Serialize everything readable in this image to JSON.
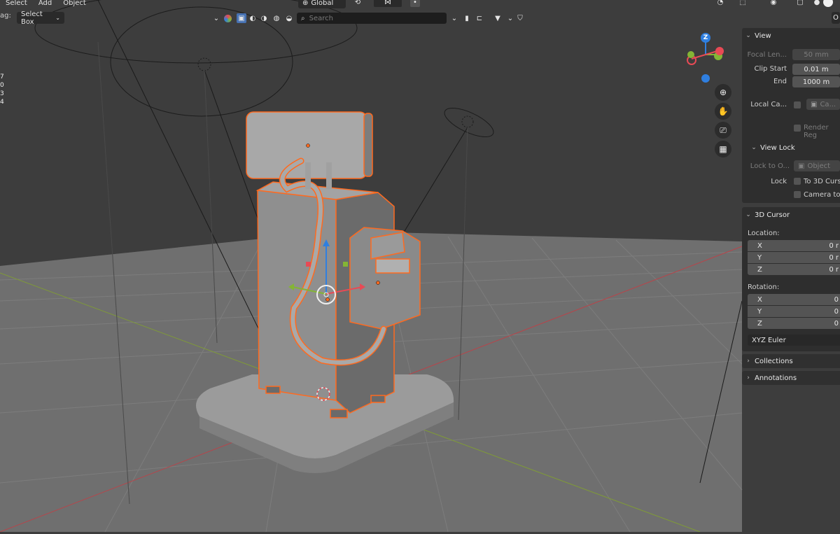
{
  "menu": {
    "select": "Select",
    "add": "Add",
    "object": "Object"
  },
  "toolbar": {
    "drag_label": "ag:",
    "select_box": "Select Box",
    "orientation": "Global",
    "search_placeholder": "Search"
  },
  "stats": [
    "7",
    "0",
    "3",
    "4"
  ],
  "npanel": {
    "view": {
      "title": "View",
      "focal_length_label": "Focal Len...",
      "focal_length_value": "50 mm",
      "clip_start_label": "Clip Start",
      "clip_start_value": "0.01 m",
      "clip_end_label": "End",
      "clip_end_value": "1000 m",
      "local_camera_label": "Local Ca...",
      "local_camera_value": "Ca...",
      "render_region_label": "Render Reg"
    },
    "view_lock": {
      "title": "View Lock",
      "lock_to_object_label": "Lock to O...",
      "lock_to_object_value": "Object",
      "lock_label": "Lock",
      "to_3d_cursor": "To 3D Curs",
      "camera_to": "Camera to"
    },
    "cursor": {
      "title": "3D Cursor",
      "location_label": "Location:",
      "location": [
        {
          "axis": "X",
          "value": "0 r"
        },
        {
          "axis": "Y",
          "value": "0 r"
        },
        {
          "axis": "Z",
          "value": "0 r"
        }
      ],
      "rotation_label": "Rotation:",
      "rotation": [
        {
          "axis": "X",
          "value": "0"
        },
        {
          "axis": "Y",
          "value": "0"
        },
        {
          "axis": "Z",
          "value": "0"
        }
      ],
      "rotation_mode": "XYZ Euler"
    },
    "collections": "Collections",
    "annotations": "Annotations"
  },
  "gizmo": {
    "z": "Z"
  },
  "colors": {
    "selection": "#ff6a1f",
    "x_axis": "#e84a55",
    "y_axis": "#84b535",
    "z_axis": "#2f7fe0",
    "viewport_bg": "#3d3d3d",
    "floor": "#6e6e6e"
  },
  "icons": [
    "zoom-icon",
    "hand-icon",
    "camera-icon",
    "grid-icon",
    "filter-icon",
    "shield-icon",
    "search-icon"
  ]
}
